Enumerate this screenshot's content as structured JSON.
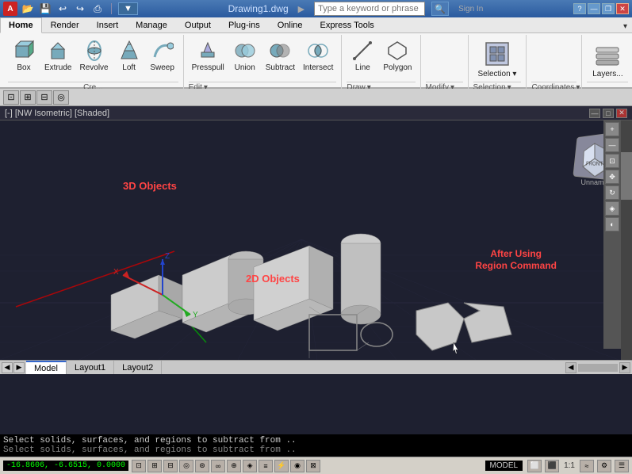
{
  "titlebar": {
    "logo": "A",
    "filename": "Drawing1.dwg",
    "search_placeholder": "Type a keyword or phrase",
    "sign_in": "Sign In",
    "min": "—",
    "restore": "❐",
    "close": "✕",
    "help": "?"
  },
  "quickaccess": {
    "icons": [
      "📂",
      "💾",
      "↩",
      "↪",
      "⎙"
    ]
  },
  "menubar": {
    "items": [
      "Home",
      "Render",
      "Insert",
      "Manage",
      "Output",
      "Plug-ins",
      "Online",
      "Express Tools"
    ]
  },
  "ribbon": {
    "tabs": [
      "Home",
      "Render",
      "Insert",
      "Manage",
      "Output",
      "Plug-ins",
      "Online",
      "Express Tools"
    ],
    "active_tab": "Home",
    "groups": {
      "create": {
        "label": "Create",
        "buttons": [
          {
            "id": "box",
            "label": "Box",
            "icon": "⬜"
          },
          {
            "id": "extrude",
            "label": "Extrude",
            "icon": "⬛"
          },
          {
            "id": "revolve",
            "label": "Revolve",
            "icon": "🔄"
          },
          {
            "id": "loft",
            "label": "Loft",
            "icon": "🔷"
          },
          {
            "id": "sweep",
            "label": "Sweep",
            "icon": "〰"
          }
        ]
      },
      "edit": {
        "label": "Edit ▾",
        "buttons": [
          {
            "id": "presspull",
            "label": "Presspull",
            "icon": "⬆"
          },
          {
            "id": "union",
            "label": "Union",
            "icon": "∪"
          },
          {
            "id": "subtract",
            "label": "Subtract",
            "icon": "⊖"
          },
          {
            "id": "intersect",
            "label": "Intersect",
            "icon": "∩"
          }
        ]
      },
      "draw": {
        "label": "Draw ▾",
        "buttons": [
          {
            "id": "line",
            "label": "Line",
            "icon": "/"
          },
          {
            "id": "polygon",
            "label": "Polygon",
            "icon": "⬡"
          }
        ]
      },
      "modify": {
        "label": "Modify ▾",
        "buttons": []
      },
      "selection": {
        "label": "Selection ▾",
        "icon": "⬛"
      },
      "coordinates": {
        "label": "Coordinates ▾"
      },
      "layers": {
        "label": "Layers..."
      }
    }
  },
  "viewport": {
    "label": "[-] [NW Isometric] [Shaded]",
    "label_3d": "3D Objects",
    "label_2d": "2D Objects",
    "label_region": "After Using\nRegion Command",
    "nav_cube_label": "Unnamed"
  },
  "tabs": {
    "items": [
      "Model",
      "Layout1",
      "Layout2"
    ]
  },
  "command_lines": [
    "Select solids, surfaces, and regions to subtract from ..",
    "Select solids, surfaces, and regions to subtract from .."
  ],
  "statusbar": {
    "coords": "-16.8606, -6.6515, 0.0000",
    "model": "MODEL",
    "scale": "1:1"
  }
}
